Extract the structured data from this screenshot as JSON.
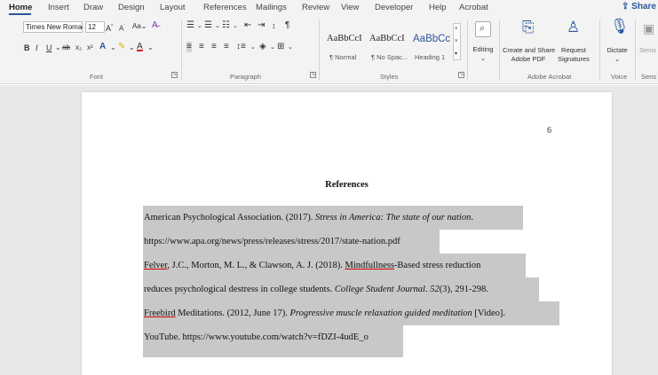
{
  "tabs": [
    "Home",
    "Insert",
    "Draw",
    "Design",
    "Layout",
    "References",
    "Mailings",
    "Review",
    "View",
    "Developer",
    "Help",
    "Acrobat"
  ],
  "share_label": "Share",
  "font": {
    "family": "Times New Roma",
    "size": "12"
  },
  "styles": [
    {
      "sample": "AaBbCcI",
      "name": "¶ Normal"
    },
    {
      "sample": "AaBbCcI",
      "name": "¶ No Spac..."
    },
    {
      "sample": "AaBbCc",
      "name": "Heading 1"
    }
  ],
  "ribbon": {
    "editing": "Editing",
    "create_share": [
      "Create and Share",
      "Adobe PDF"
    ],
    "request_signatures": [
      "Request",
      "Signatures"
    ],
    "dictate": "Dictate",
    "sensitivity": "Sensi"
  },
  "group_labels": {
    "font": "Font",
    "paragraph": "Paragraph",
    "styles": "Styles",
    "adobe": "Adobe Acrobat",
    "voice": "Voice",
    "sens": "Sens"
  },
  "document": {
    "page_number": "6",
    "heading": "References",
    "lines": [
      {
        "parts": [
          {
            "text": "American Psychological Association. (2017). "
          },
          {
            "text": "Stress in America: The state of our nation",
            "italic": true
          },
          {
            "text": "."
          }
        ]
      },
      {
        "parts": [
          {
            "text": "https://www.apa.org/news/press/releases/stress/2017/state-nation.pdf"
          }
        ]
      },
      {
        "parts": [
          {
            "text": "Felver",
            "underline": true
          },
          {
            "text": ", J.C., Morton, M. L., & Clawson, A. J. (2018). "
          },
          {
            "text": "Mindfullness",
            "underline": true
          },
          {
            "text": "-Based stress reduction"
          }
        ]
      },
      {
        "parts": [
          {
            "text": "reduces psychological destress in college students. "
          },
          {
            "text": "College Student Journal",
            "italic": true
          },
          {
            "text": ". "
          },
          {
            "text": "52",
            "italic": true
          },
          {
            "text": "(3), 291-298."
          }
        ]
      },
      {
        "parts": [
          {
            "text": "Freebird",
            "underline": true
          },
          {
            "text": " Meditations. (2012, June 17). "
          },
          {
            "text": "Progressive muscle relaxation guided meditation",
            "italic": true
          },
          {
            "text": " [Video]."
          }
        ]
      },
      {
        "parts": [
          {
            "text": "YouTube. https://www.youtube.com/watch?v=fDZI-4udE_o"
          }
        ]
      }
    ]
  }
}
